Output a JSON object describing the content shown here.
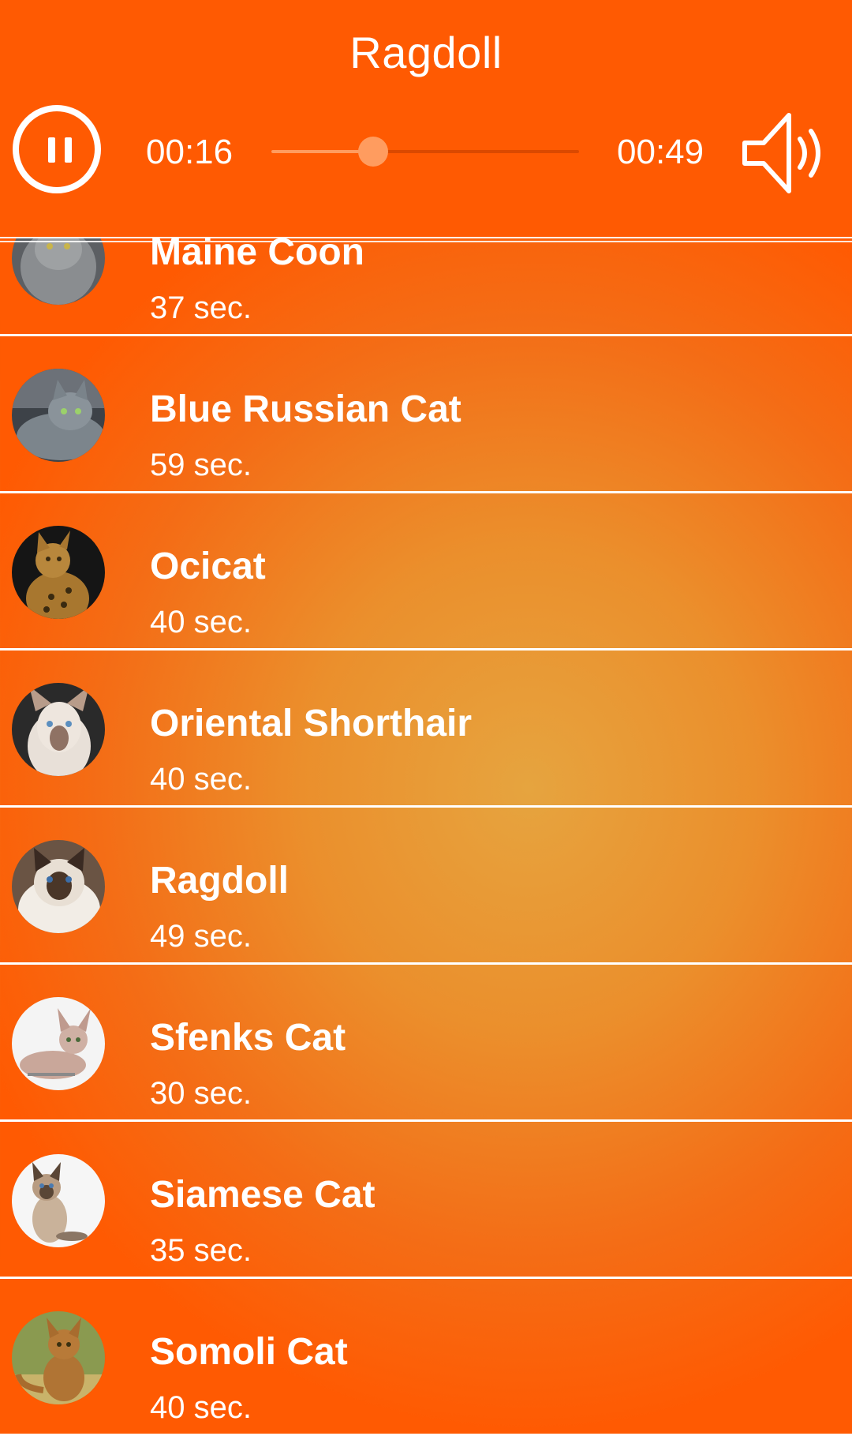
{
  "player": {
    "title": "Ragdoll",
    "current_time": "00:16",
    "duration": "00:49",
    "progress": 0.33,
    "pause_icon": "pause-icon",
    "volume_icon": "volume-icon"
  },
  "colors": {
    "primary": "#ff5a02",
    "center_glow": "#e6a43f",
    "divider": "#ffffff",
    "seek_accent": "#ff9c5f"
  },
  "tracks": [
    {
      "title": "Maine Coon",
      "duration": "37 sec."
    },
    {
      "title": "Blue Russian Cat",
      "duration": "59 sec."
    },
    {
      "title": "Ocicat",
      "duration": "40 sec."
    },
    {
      "title": "Oriental Shorthair",
      "duration": "40 sec."
    },
    {
      "title": "Ragdoll",
      "duration": "49 sec."
    },
    {
      "title": "Sfenks Cat",
      "duration": "30 sec."
    },
    {
      "title": "Siamese Cat",
      "duration": "35 sec."
    },
    {
      "title": "Somoli Cat",
      "duration": "40 sec."
    }
  ]
}
